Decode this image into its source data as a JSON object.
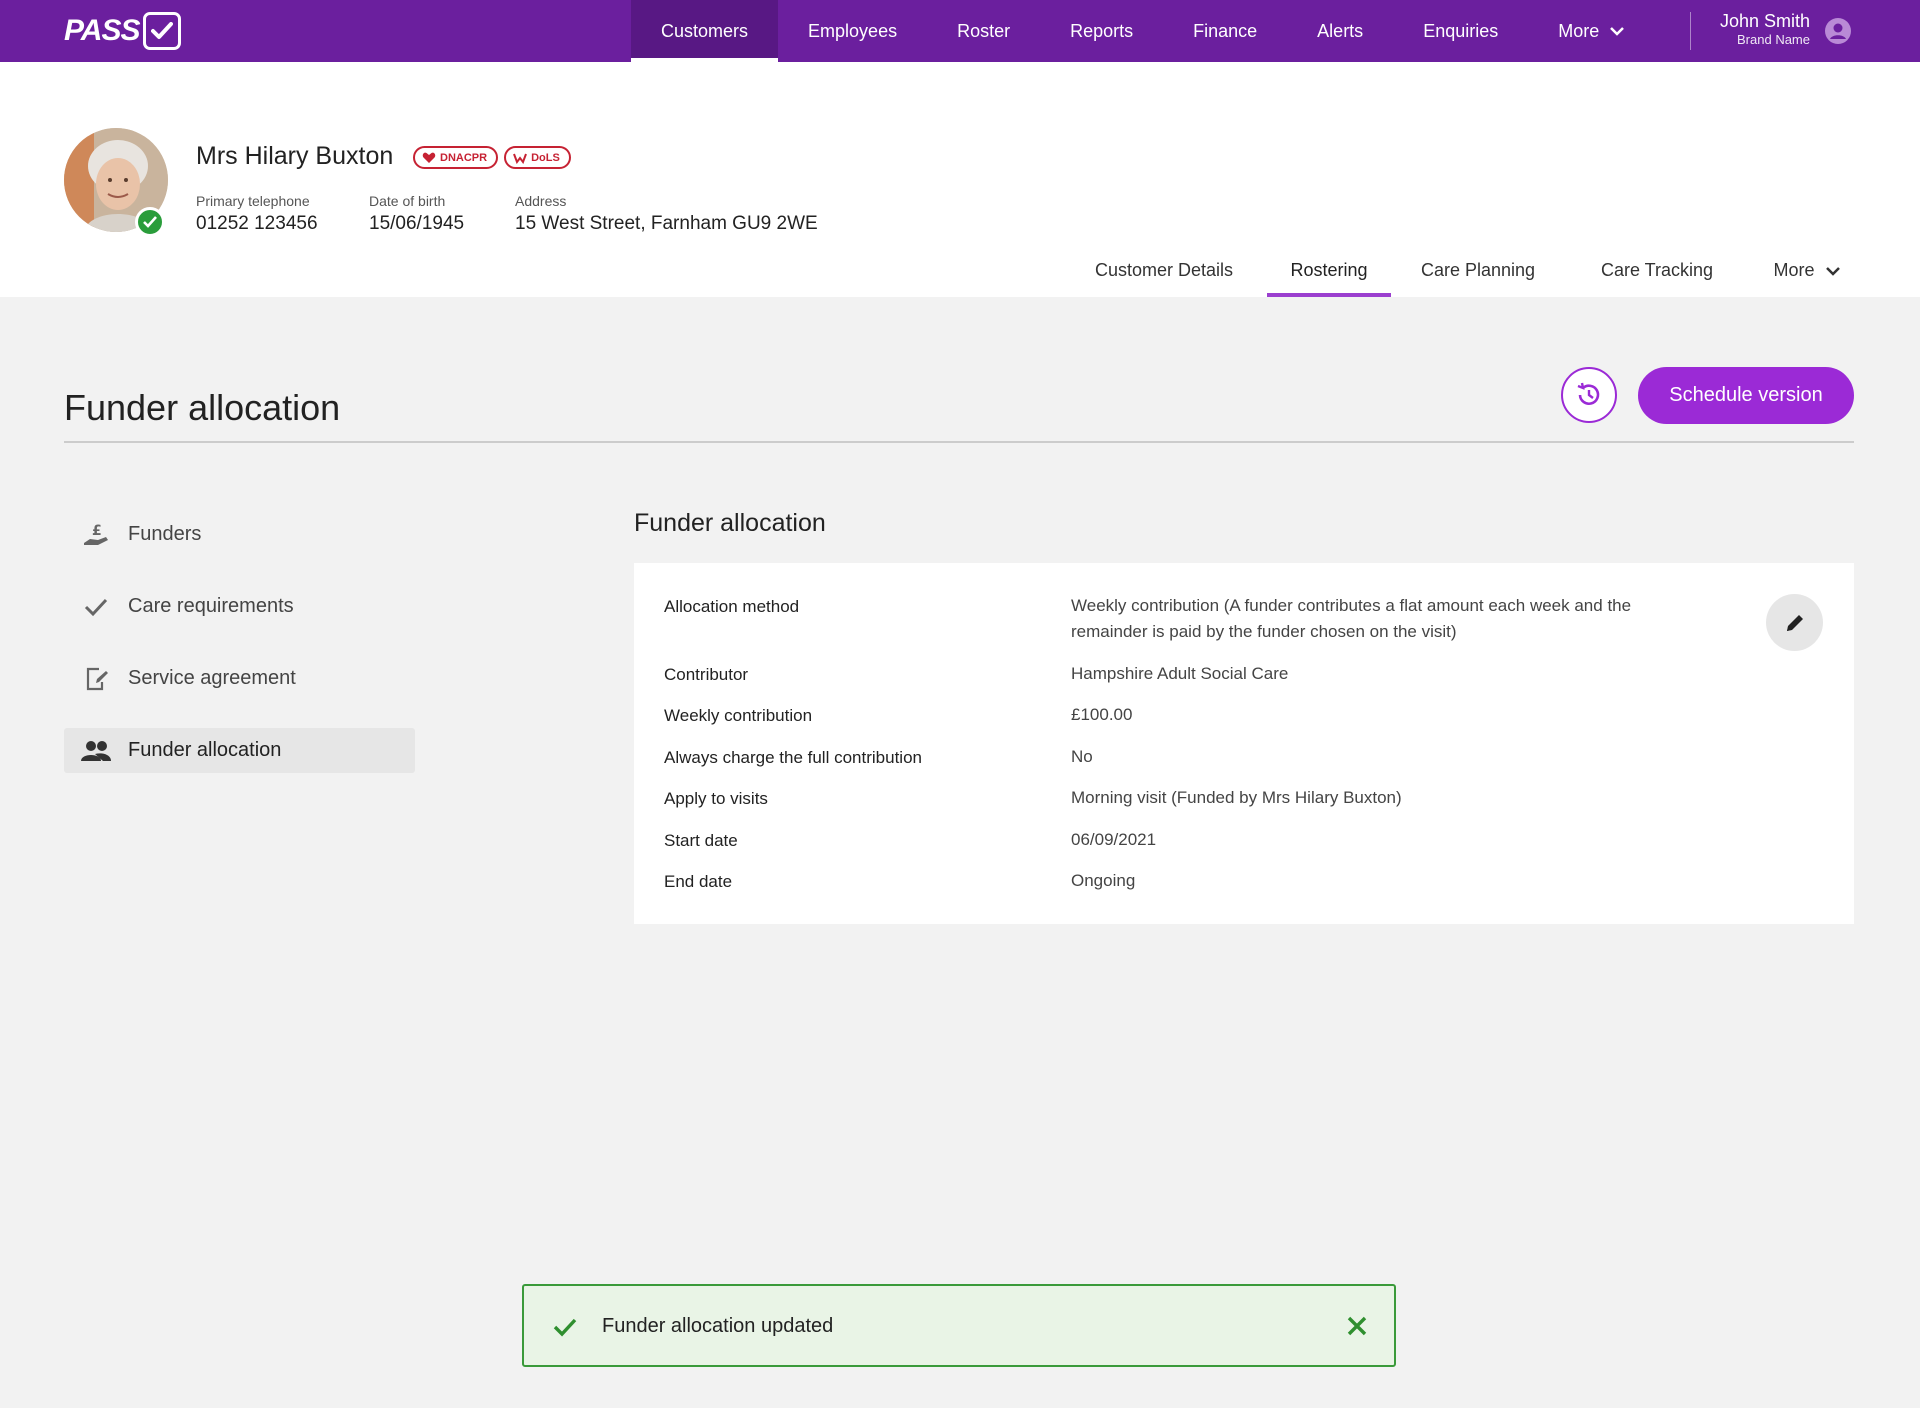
{
  "app": {
    "logo_text": "PASS",
    "brand_color": "#6b1f9e",
    "accent_color": "#9b2ad6"
  },
  "topnav": {
    "items": [
      {
        "label": "Customers",
        "active": true
      },
      {
        "label": "Employees"
      },
      {
        "label": "Roster"
      },
      {
        "label": "Reports"
      },
      {
        "label": "Finance"
      },
      {
        "label": "Alerts"
      },
      {
        "label": "Enquiries"
      }
    ],
    "more_label": "More",
    "user": {
      "name": "John Smith",
      "brand": "Brand Name",
      "icon": "account-circle-icon"
    }
  },
  "customer": {
    "name": "Mrs Hilary Buxton",
    "verified": true,
    "badges": [
      {
        "label": "DNACPR",
        "icon": "heart-icon",
        "color": "#c62233"
      },
      {
        "label": "DoLS",
        "icon": "hands-icon",
        "color": "#c62233"
      }
    ],
    "fields": {
      "phone_label": "Primary telephone",
      "phone": "01252 123456",
      "dob_label": "Date of birth",
      "dob": "15/06/1945",
      "address_label": "Address",
      "address": "15 West Street, Farnham GU9 2WE"
    }
  },
  "subtabs": {
    "items": [
      "Customer Details",
      "Rostering",
      "Care Planning",
      "Care Tracking"
    ],
    "active": "Rostering",
    "more_label": "More"
  },
  "page": {
    "title": "Funder allocation",
    "history_icon": "history-icon",
    "schedule_label": "Schedule version"
  },
  "sidebar": {
    "items": [
      {
        "label": "Funders",
        "icon": "pound-hand-icon"
      },
      {
        "label": "Care requirements",
        "icon": "check-icon"
      },
      {
        "label": "Service agreement",
        "icon": "document-edit-icon"
      },
      {
        "label": "Funder allocation",
        "icon": "people-icon",
        "active": true
      }
    ]
  },
  "detail": {
    "title": "Funder allocation",
    "edit_icon": "pencil-icon",
    "rows": [
      {
        "label": "Allocation method",
        "value": "Weekly contribution (A funder contributes a flat amount each week and the remainder is paid by the funder chosen on the visit)"
      },
      {
        "label": "Contributor",
        "value": "Hampshire Adult Social Care"
      },
      {
        "label": "Weekly contribution",
        "value": "£100.00"
      },
      {
        "label": "Always charge the full contribution",
        "value": "No"
      },
      {
        "label": "Apply to visits",
        "value": "Morning visit (Funded by Mrs Hilary Buxton)"
      },
      {
        "label": "Start date",
        "value": "06/09/2021"
      },
      {
        "label": "End date",
        "value": "Ongoing"
      }
    ]
  },
  "toast": {
    "message": "Funder allocation updated",
    "status_color": "#3a9a3a"
  }
}
